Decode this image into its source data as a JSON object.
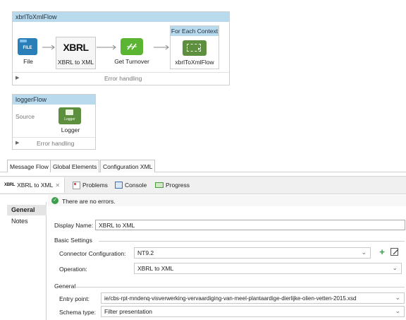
{
  "flows": {
    "xbrl": {
      "title": "xbrlToXmlFlow",
      "nodes": [
        {
          "label": "File",
          "icon_text": "FILE"
        },
        {
          "label": "XBRL to XML",
          "icon_text": "XBRL"
        },
        {
          "label": "Get Turnover"
        },
        {
          "label": "xbrlToXmlFlow"
        }
      ],
      "scope_title": "For Each Context",
      "error_handling": "Error handling"
    },
    "logger": {
      "title": "loggerFlow",
      "source_label": "Source",
      "node_label": "Logger",
      "icon_text": "Logger",
      "error_handling": "Error handling"
    }
  },
  "editor_tabs": [
    "Message Flow",
    "Global Elements",
    "Configuration XML"
  ],
  "views": {
    "active_tab": {
      "icon_text": "XBRL",
      "label": "XBRL to XML"
    },
    "tabs": [
      "Problems",
      "Console",
      "Progress"
    ]
  },
  "sidebar": [
    "General",
    "Notes"
  ],
  "status": "There are no errors.",
  "display_name": {
    "label": "Display Name:",
    "value": "XBRL to XML"
  },
  "basic": {
    "title": "Basic Settings",
    "connector_label": "Connector Configuration:",
    "connector_value": "NT9.2",
    "operation_label": "Operation:",
    "operation_value": "XBRL to XML"
  },
  "general": {
    "title": "General",
    "entry_label": "Entry point:",
    "entry_value": "ie/cbs-rpt-mndenq-visverwerking-vervaardiging-van-meel-plantaardige-dierlijke-olien-vetten-2015.xsd",
    "schema_label": "Schema type:",
    "schema_value": "Filter presentation"
  },
  "colors": {
    "flow_title_bg": "#b9d9ec",
    "file_icon": "#2a7fb8",
    "transform_icon": "#5bb532",
    "logger_icon": "#5e8f3e",
    "status_ok": "#3aa04a"
  }
}
